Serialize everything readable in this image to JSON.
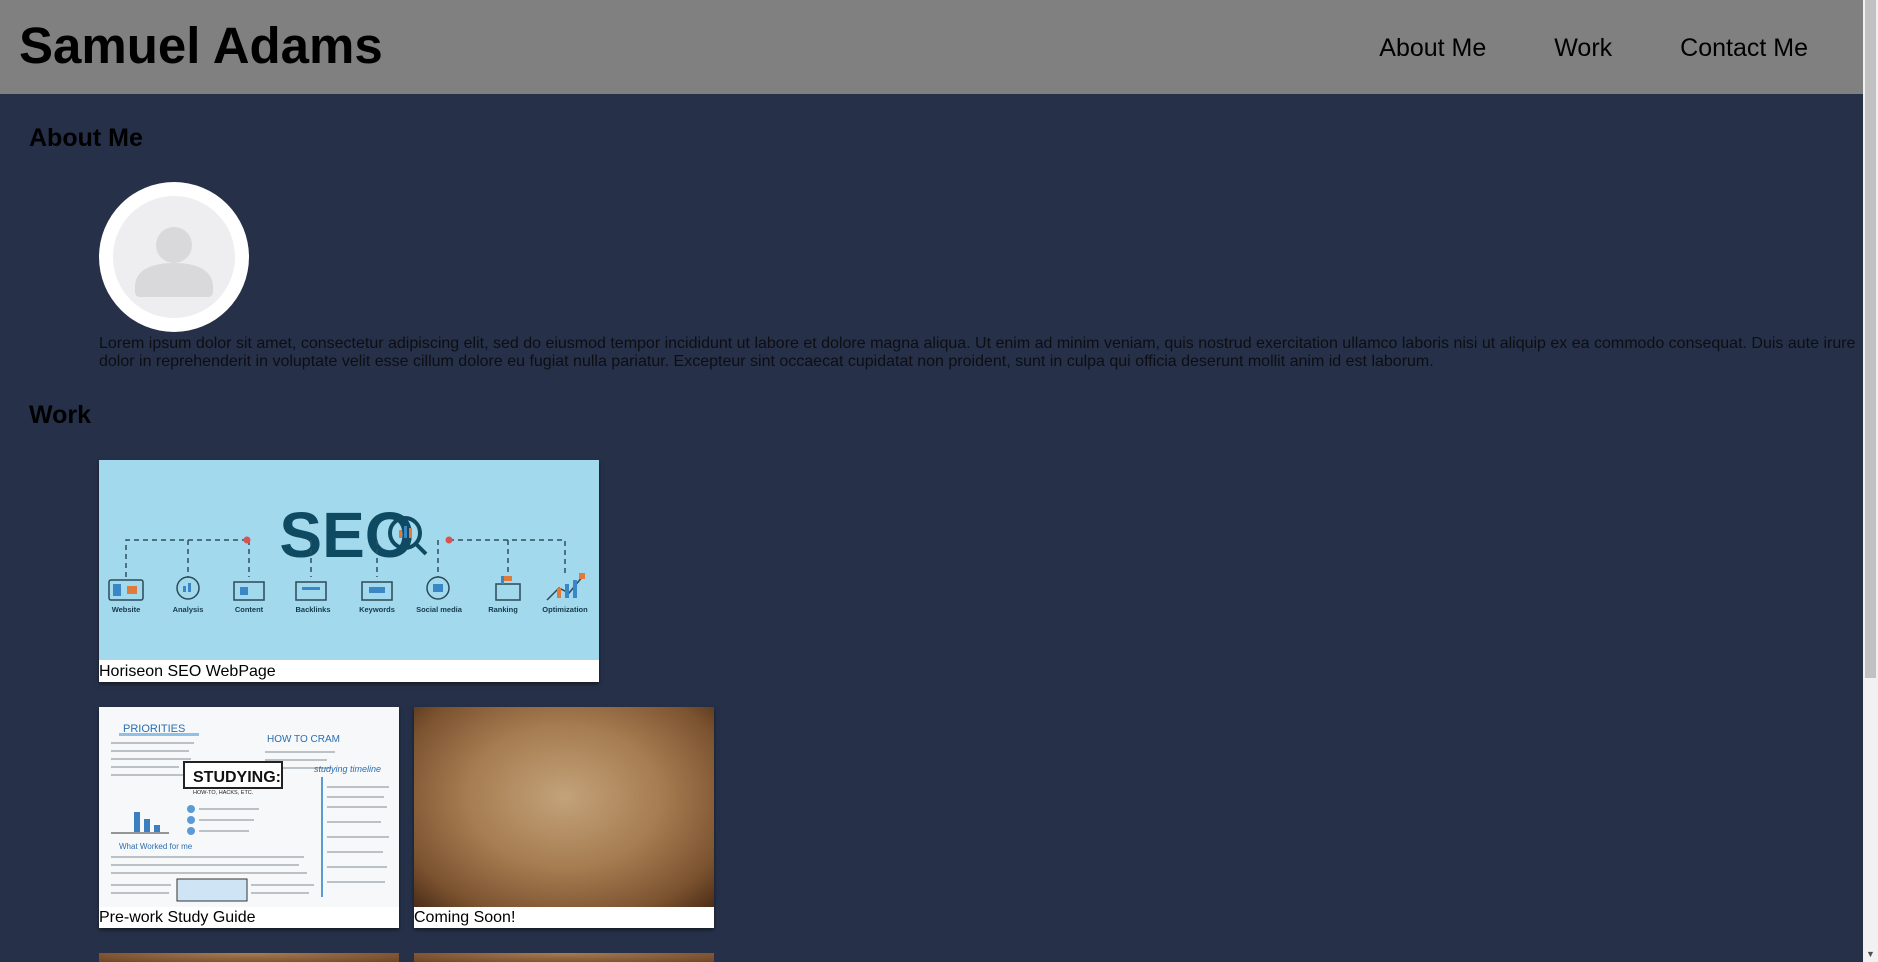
{
  "header": {
    "title": "Samuel Adams",
    "nav": [
      "About Me",
      "Work",
      "Contact Me"
    ]
  },
  "about": {
    "heading": "About Me",
    "avatar_icon": "user-silhouette-icon",
    "text": "Lorem ipsum dolor sit amet, consectetur adipiscing elit, sed do eiusmod tempor incididunt ut labore et dolore magna aliqua. Ut enim ad minim veniam, quis nostrud exercitation ullamco laboris nisi ut aliquip ex ea commodo consequat. Duis aute irure dolor in reprehenderit in voluptate velit esse cillum dolore eu fugiat nulla pariatur. Excepteur sint occaecat cupidatat non proident, sunt in culpa qui officia deserunt mollit anim id est laborum."
  },
  "work": {
    "heading": "Work",
    "projects": [
      {
        "caption": "Horiseon SEO WebPage",
        "image": {
          "title": "SEO",
          "labels": [
            "Website",
            "Analysis",
            "Content",
            "Backlinks",
            "Keywords",
            "Social media",
            "Ranking",
            "Optimization"
          ]
        }
      },
      {
        "caption": "Pre-work Study Guide",
        "image": {
          "texts": [
            "PRIORITIES",
            "HOW TO CRAM",
            "STUDYING:",
            "HOW-TO, HACKS, ETC.",
            "studying timeline",
            "What Worked for me"
          ]
        }
      },
      {
        "caption": "Coming Soon!"
      }
    ]
  },
  "colors": {
    "page_background": "#263149",
    "header_background": "#808080",
    "seo_background": "#a3d9ec",
    "seo_title": "#0f4a63"
  }
}
